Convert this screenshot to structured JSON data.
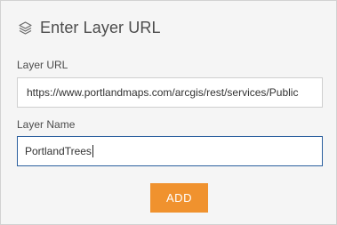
{
  "header": {
    "icon": "layers-icon",
    "title": "Enter Layer URL"
  },
  "form": {
    "url_label": "Layer URL",
    "url_value": "https://www.portlandmaps.com/arcgis/rest/services/Public",
    "name_label": "Layer Name",
    "name_value": "PortlandTrees"
  },
  "actions": {
    "add_label": "ADD"
  },
  "colors": {
    "accent": "#f0922e",
    "focus_border": "#2b5f9e"
  }
}
